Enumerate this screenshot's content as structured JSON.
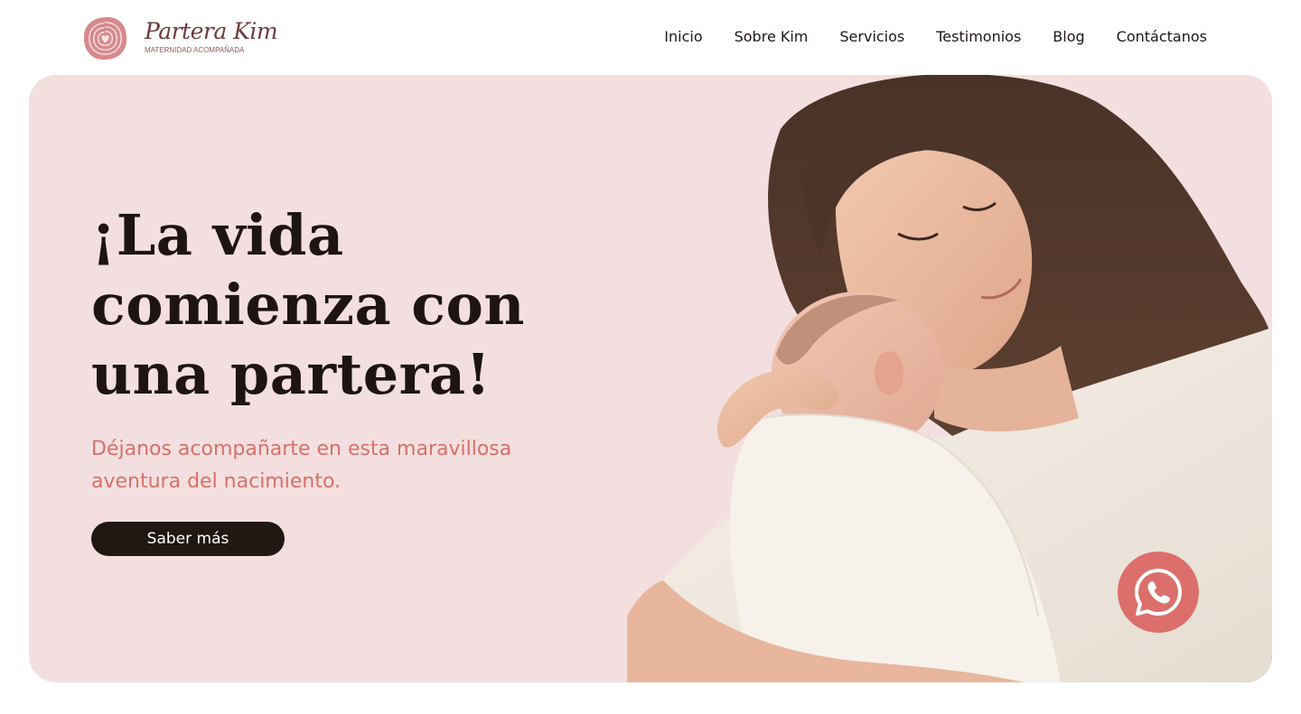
{
  "brand": {
    "name": "Partera Kim",
    "tagline": "MATERNIDAD ACOMPAÑADA",
    "logo_icon": "spiral-heart-icon",
    "logo_color": "#d78a8c"
  },
  "nav": {
    "items": [
      {
        "label": "Inicio"
      },
      {
        "label": "Sobre Kim"
      },
      {
        "label": "Servicios"
      },
      {
        "label": "Testimonios"
      },
      {
        "label": "Blog"
      },
      {
        "label": "Contáctanos"
      }
    ]
  },
  "hero": {
    "title_lines": [
      "¡La vida",
      "comienza con",
      "una partera!"
    ],
    "subtitle": "Déjanos acompañarte en esta maravillosa aventura del nacimiento.",
    "cta_label": "Saber más",
    "photo": "mother-holding-newborn-photo",
    "background_color": "#f3dfdf",
    "title_color": "#1e1513",
    "subtitle_color": "#d8706a",
    "cta_color": "#211713"
  },
  "whatsapp": {
    "icon": "whatsapp-icon",
    "color": "#dc6f6b"
  }
}
